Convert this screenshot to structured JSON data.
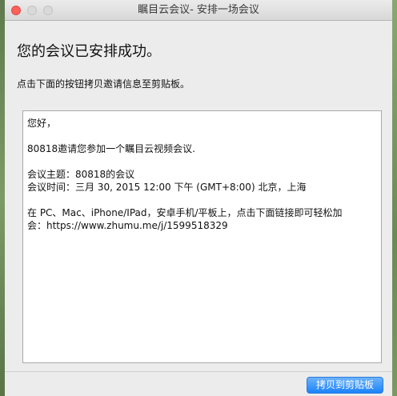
{
  "window": {
    "title": "瞩目云会议- 安排一场会议"
  },
  "main": {
    "heading": "您的会议已安排成功。",
    "instruction": "点击下面的按钮拷贝邀请信息至剪贴板。"
  },
  "invite": {
    "greeting": "您好，",
    "invitation": "80818邀请您参加一个瞩目云视频会议.",
    "topic": "会议主题：80818的会议",
    "time": "会议时间：三月 30, 2015 12:00 下午 (GMT+8:00) 北京，上海",
    "join_line1": "在 PC、Mac、iPhone/IPad，安卓手机/平板上，点击下面链接即可轻松加",
    "join_line2": "会：https://www.zhumu.me/j/1599518329"
  },
  "footer": {
    "copy_button_label": "拷贝到剪贴板"
  },
  "colors": {
    "close_button": "#fc605b",
    "primary_button": "#1a82fb"
  }
}
